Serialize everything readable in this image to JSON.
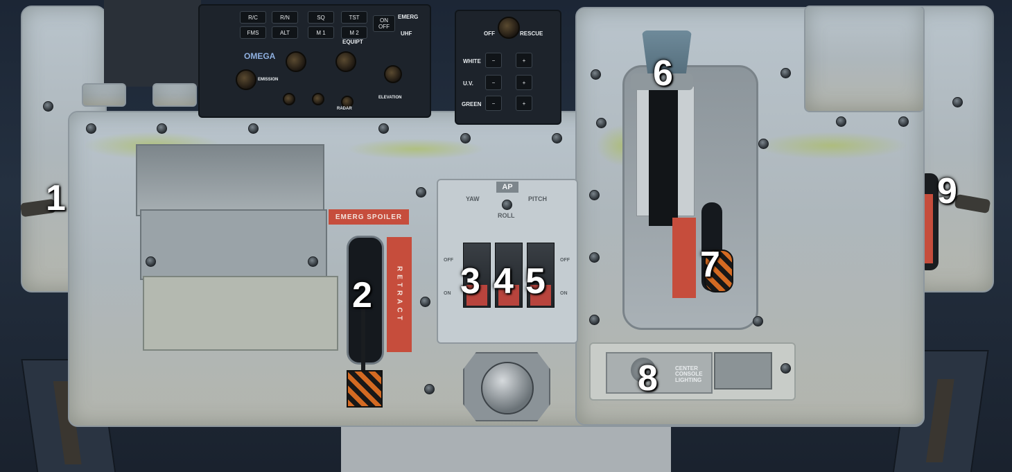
{
  "callouts": [
    "1",
    "2",
    "3",
    "4",
    "5",
    "6",
    "7",
    "8",
    "9"
  ],
  "radio_panel": {
    "keys_row1": [
      "R/C",
      "R/N",
      "SQ",
      "TST"
    ],
    "keys_row2": [
      "FMS",
      "ALT",
      "M 1",
      "M 2"
    ],
    "on_off": "ON\nOFF",
    "emerg": "EMERG",
    "uhf": "UHF",
    "equipt": "EQUIPT",
    "logo": "OMEGA",
    "emission": "EMISSION",
    "elevation": "ELEVATION",
    "radar": "RADAR"
  },
  "light_panel": {
    "off": "OFF",
    "rescue": "RESCUE",
    "white": "WHITE",
    "uv": "U.V.",
    "green": "GREEN",
    "minus": "−",
    "plus": "+"
  },
  "spoiler": {
    "title": "EMERG  SPOILER",
    "retract": "RETRACT"
  },
  "autopilot": {
    "ap": "AP",
    "yaw": "YAW",
    "pitch": "PITCH",
    "roll": "ROLL",
    "off": "OFF",
    "on": "ON"
  },
  "lighting": {
    "text": "CENTER\nCONSOLE\nLIGHTING"
  },
  "colors": {
    "panel": "#b5bec4",
    "accent_red": "#c64d3c",
    "hazard_orange": "#d46a22"
  }
}
